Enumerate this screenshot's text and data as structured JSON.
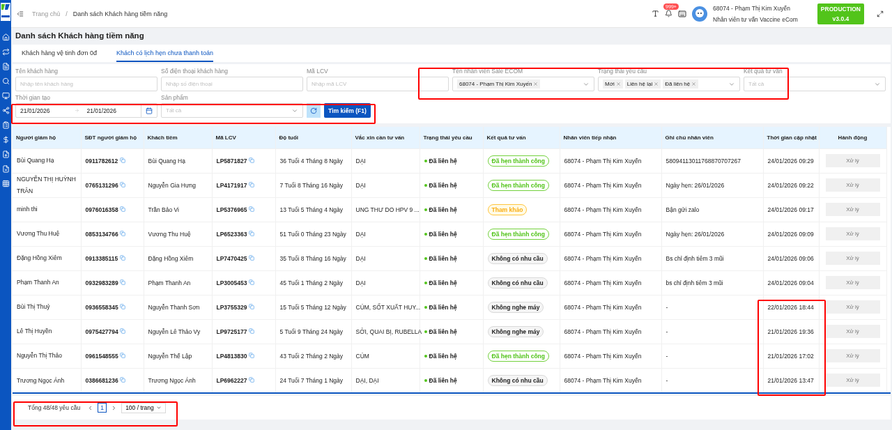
{
  "breadcrumb": [
    "Trang chủ",
    "Danh sách Khách hàng tiềm năng"
  ],
  "breadcrumb_separator": "/",
  "header": {
    "notification_count": "999+",
    "user_name": "68074 - Phạm Thị Kim Xuyến",
    "user_role": "Nhân viên tư vấn Vaccine eCom",
    "environment": "PRODUCTION",
    "version": "v3.0.4"
  },
  "page_title": "Danh sách Khách hàng tiềm năng",
  "tabs": [
    {
      "label": "Khách hàng vệ tinh đơn 0đ",
      "selected": false
    },
    {
      "label": "Khách có lịch hẹn chưa thanh toán",
      "selected": true
    }
  ],
  "filters": [
    {
      "kind": "text",
      "label": "Tên khách hàng",
      "placeholder": "Nhập tên khách hàng"
    },
    {
      "kind": "text",
      "label": "Số điện thoại khách hàng",
      "placeholder": "Nhập số điện thoại"
    },
    {
      "kind": "text",
      "label": "Mã LCV",
      "placeholder": "Nhập mã LCV"
    },
    {
      "kind": "tags",
      "label": "Tên nhân viên Sale ECOM",
      "tags": [
        "68074 - Phạm Thị Kim Xuyến"
      ]
    },
    {
      "kind": "tags",
      "label": "Trạng thái yêu cầu",
      "tags": [
        "Mới",
        "Liên hệ lại",
        "Đã liên hệ"
      ]
    },
    {
      "kind": "select",
      "label": "Kết quả tư vấn",
      "placeholder": "Tất cả"
    },
    {
      "kind": "daterange",
      "label": "Thời gian tạo",
      "from": "21/01/2026",
      "to": "21/01/2026"
    },
    {
      "kind": "select",
      "label": "Sản phẩm",
      "placeholder": "Tất cả"
    }
  ],
  "search_button": "Tìm kiếm (F1)",
  "table": {
    "columns": [
      "Người giám hộ",
      "SĐT người giám hộ",
      "Khách tiêm",
      "Mã LCV",
      "Độ tuổi",
      "Vắc xin cần tư vấn",
      "Trạng thái yêu cầu",
      "Kết quả tư vấn",
      "Nhân viên tiếp nhận",
      "Ghi chú nhân viên",
      "Thời gian cập nhật",
      "Hành động"
    ],
    "rows": [
      {
        "guardian": "Bùi Quang Hạ",
        "phone": "0911782612",
        "customer": "Bùi Quang Hạ",
        "lcv": "LP5871827",
        "age": "36 Tuổi 4 Tháng 8 Ngày",
        "vaccine": "DẠI",
        "status": {
          "label": "Đã liên hệ",
          "color": "#52c41a"
        },
        "result": {
          "label": "Đã hẹn thành công",
          "kind": "success"
        },
        "staff": "68074 - Phạm Thị Kim Xuyến",
        "note": "58094113011768870707267",
        "updated": "24/01/2026 09:29",
        "action": {
          "label": "Xử lý",
          "disabled": true
        }
      },
      {
        "guardian": "NGUYỄN THỊ HUỲNH TRÂN",
        "phone": "0765131296",
        "customer": "Nguyễn Gia Hưng",
        "lcv": "LP4171917",
        "age": "7 Tuổi 8 Tháng 16 Ngày",
        "vaccine": "DẠI",
        "status": {
          "label": "Đã liên hệ",
          "color": "#52c41a"
        },
        "result": {
          "label": "Đã hẹn thành công",
          "kind": "success"
        },
        "staff": "68074 - Phạm Thị Kim Xuyến",
        "note": "Ngày hẹn: 26/01/2026",
        "updated": "24/01/2026 09:22",
        "action": {
          "label": "Xử lý",
          "disabled": true
        }
      },
      {
        "guardian": "minh thi",
        "phone": "0976016358",
        "customer": "Trần Bảo Vi",
        "lcv": "LP5376965",
        "age": "13 Tuổi 5 Tháng 4 Ngày",
        "vaccine": "UNG THƯ DO HPV 9 ...",
        "status": {
          "label": "Đã liên hệ",
          "color": "#52c41a"
        },
        "result": {
          "label": "Tham khảo",
          "kind": "warning"
        },
        "staff": "68074 - Phạm Thị Kim Xuyến",
        "note": "Bận gửi zalo",
        "updated": "24/01/2026 09:17",
        "action": {
          "label": "Xử lý",
          "disabled": true
        }
      },
      {
        "guardian": "Vương Thu Huệ",
        "phone": "0853134766",
        "customer": "Vương Thu Huệ",
        "lcv": "LP6523363",
        "age": "51 Tuổi 0 Tháng 23 Ngày",
        "vaccine": "DẠI",
        "status": {
          "label": "Đã liên hệ",
          "color": "#52c41a"
        },
        "result": {
          "label": "Đã hẹn thành công",
          "kind": "success"
        },
        "staff": "68074 - Phạm Thị Kim Xuyến",
        "note": "Ngày hẹn: 26/01/2026",
        "updated": "24/01/2026 09:09",
        "action": {
          "label": "Xử lý",
          "disabled": true
        }
      },
      {
        "guardian": "Đặng Hồng Xiêm",
        "phone": "0913385115",
        "customer": "Đặng Hồng Xiêm",
        "lcv": "LP7470425",
        "age": "35 Tuổi 8 Tháng 16 Ngày",
        "vaccine": "DẠI",
        "status": {
          "label": "Đã liên hệ",
          "color": "#52c41a"
        },
        "result": {
          "label": "Không có nhu cầu",
          "kind": "neutral"
        },
        "staff": "68074 - Phạm Thị Kim Xuyến",
        "note": "Bs chỉ định tiêm 3 mũi",
        "updated": "24/01/2026 09:06",
        "action": {
          "label": "Xử lý",
          "disabled": true
        }
      },
      {
        "guardian": "Phạm Thanh An",
        "phone": "0932983289",
        "customer": "Phạm Thanh An",
        "lcv": "LP3005453",
        "age": "45 Tuổi 1 Tháng 2 Ngày",
        "vaccine": "DẠI",
        "status": {
          "label": "Đã liên hệ",
          "color": "#52c41a"
        },
        "result": {
          "label": "Không có nhu cầu",
          "kind": "neutral"
        },
        "staff": "68074 - Phạm Thị Kim Xuyến",
        "note": "bs chỉ định tiêm 3 mũi",
        "updated": "24/01/2026 09:04",
        "action": {
          "label": "Xử lý",
          "disabled": true
        }
      },
      {
        "guardian": "Bùi Thị Thuỷ",
        "phone": "0936558345",
        "customer": "Nguyễn Thanh Sơn",
        "lcv": "LP3755329",
        "age": "15 Tuổi 5 Tháng 12 Ngày",
        "vaccine": "CÚM, SỐT XUẤT HUY...",
        "status": {
          "label": "Đã liên hệ",
          "color": "#52c41a"
        },
        "result": {
          "label": "Không nghe máy",
          "kind": "neutral"
        },
        "staff": "68074 - Phạm Thị Kim Xuyến",
        "note": "-",
        "updated": "22/01/2026 18:44",
        "action": {
          "label": "Xử lý",
          "disabled": true
        }
      },
      {
        "guardian": "Lê Thị Huyền",
        "phone": "0975427794",
        "customer": "Nguyễn Lê Thảo Vy",
        "lcv": "LP9725177",
        "age": "5 Tuổi 9 Tháng 24 Ngày",
        "vaccine": "SỞI, QUAI BỊ, RUBELLA",
        "status": {
          "label": "Đã liên hệ",
          "color": "#52c41a"
        },
        "result": {
          "label": "Không nghe máy",
          "kind": "neutral"
        },
        "staff": "68074 - Phạm Thị Kim Xuyến",
        "note": "-",
        "updated": "21/01/2026 19:36",
        "action": {
          "label": "Xử lý",
          "disabled": true
        }
      },
      {
        "guardian": "Nguyễn Thị Thảo",
        "phone": "0961548555",
        "customer": "Nguyễn Thế Lập",
        "lcv": "LP4813830",
        "age": "43 Tuổi 2 Tháng 2 Ngày",
        "vaccine": "CÚM",
        "status": {
          "label": "Đã liên hệ",
          "color": "#52c41a"
        },
        "result": {
          "label": "Đã hẹn thành công",
          "kind": "success"
        },
        "staff": "68074 - Phạm Thị Kim Xuyến",
        "note": "-",
        "updated": "21/01/2026 17:02",
        "action": {
          "label": "Xử lý",
          "disabled": true
        }
      },
      {
        "guardian": "Trương Ngọc Ánh",
        "phone": "0386681236",
        "customer": "Trương Ngọc Ánh",
        "lcv": "LP6962227",
        "age": "24 Tuổi 7 Tháng 1 Ngày",
        "vaccine": "DẠI, DẠI",
        "status": {
          "label": "Đã liên hệ",
          "color": "#52c41a"
        },
        "result": {
          "label": "Không có nhu cầu",
          "kind": "neutral"
        },
        "staff": "68074 - Phạm Thị Kim Xuyến",
        "note": "-",
        "updated": "21/01/2026 13:47",
        "action": {
          "label": "Xử lý",
          "disabled": true
        }
      }
    ]
  },
  "pagination": {
    "total": "Tổng 48/48 yêu cầu",
    "pages": [
      {
        "label": "1",
        "selected": true
      }
    ],
    "page_size": "100 / trang"
  }
}
